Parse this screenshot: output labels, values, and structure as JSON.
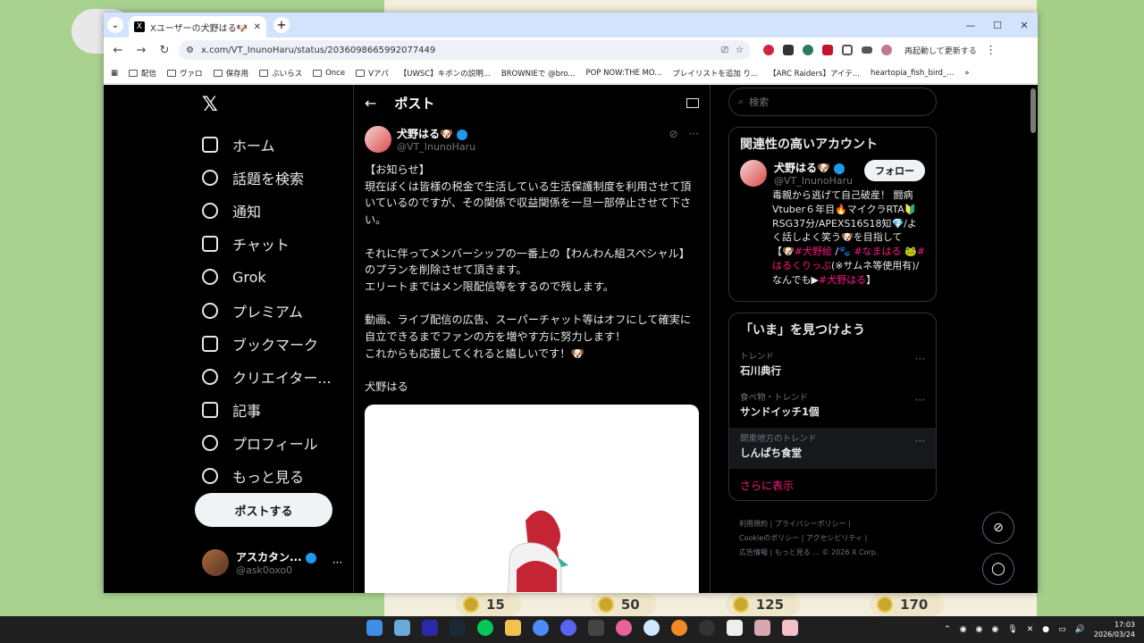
{
  "browser": {
    "tab_title": "Xユーザーの犬野はる🐶さん:「【お知",
    "url": "x.com/VT_InunoHaru/status/2036098665992077449",
    "reload_text": "再起動して更新する",
    "bookmarks": [
      "配信",
      "ヴァロ",
      "保存用",
      "ぶいらス",
      "Once",
      "Vアパ",
      "【UWSC】キボンの説明...",
      "BROWNIEで @bro...",
      "POP NOW:THE MO...",
      "プレイリストを追加 り...",
      "【ARC Raiders】アイテ...",
      "heartopia_fish_bird_..."
    ]
  },
  "sidebar": {
    "items": [
      "ホーム",
      "話題を検索",
      "通知",
      "チャット",
      "Grok",
      "プレミアム",
      "ブックマーク",
      "クリエイター...",
      "記事",
      "プロフィール",
      "もっと見る"
    ],
    "post_button": "ポストする",
    "user": {
      "name": "アスカタン...",
      "handle": "@ask0oxo0"
    }
  },
  "main": {
    "title": "ポスト",
    "author": {
      "name": "犬野はる🐶",
      "handle": "@VT_InunoHaru"
    },
    "body": "【お知らせ】\n現在ぼくは皆様の税金で生活している生活保護制度を利用させて頂いているのですが、その関係で収益関係を一旦一部停止させて下さい。\n\nそれに伴ってメンバーシップの一番上の【わんわん組スペシャル】のプランを削除させて頂きます。\nエリートまではメン限配信等をするので残します。\n\n動画、ライブ配信の広告、スーパーチャット等はオフにして確実に自立できるまでファンの方を増やす方に努力します！\nこれからも応援してくれると嬉しいです！🐶\n\n犬野はる"
  },
  "right": {
    "search_placeholder": "検索",
    "relevant": {
      "title": "関連性の高いアカウント",
      "name": "犬野はる🐶",
      "handle": "@VT_InunoHaru",
      "follow": "フォロー",
      "bio_1": "毒親から逃げて自己破産！ 闘病Vtuber６年目🔥マイクラRTA🔰RSG37分/APEXS16S18知💎/よく話しよく笑う🐶を目指して 【🐶",
      "tag1": "#犬野絵",
      "sep1": " /🐾 ",
      "tag2": "#なまはる",
      "sep2": " 🐸",
      "tag3": "#はるくりっぷ",
      "bio_2": "(※サムネ等使用有)/なんでも▶",
      "tag4": "#犬野はる",
      "bio_3": "】"
    },
    "trends": {
      "title": "「いま」を見つけよう",
      "items": [
        {
          "cat": "トレンド",
          "name": "石川典行"
        },
        {
          "cat": "食べ物・トレンド",
          "name": "サンドイッチ1個"
        },
        {
          "cat": "関東地方のトレンド",
          "name": "しんぱち食堂"
        }
      ],
      "more": "さらに表示"
    },
    "footer": [
      "利用規約",
      "プライバシーポリシー",
      "Cookieのポリシー",
      "アクセシビリティ",
      "広告情報",
      "もっと見る ...",
      "© 2026 X Corp."
    ]
  },
  "game": {
    "coins": [
      "15",
      "50",
      "125",
      "170"
    ]
  },
  "taskbar": {
    "time": "17:03",
    "date": "2026/03/24"
  },
  "colors": {
    "accent": "#f91880",
    "verified": "#1d9bf0",
    "background": "#000000"
  }
}
